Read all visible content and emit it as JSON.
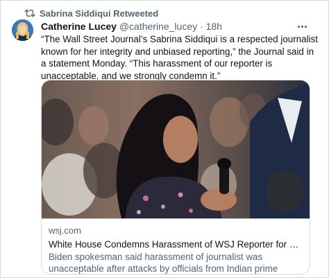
{
  "retweet": {
    "label": "Sabrina Siddiqui Retweeted",
    "icon": "retweet-icon"
  },
  "tweet": {
    "author_name": "Catherine Lucey",
    "author_handle": "@catherine_lucey",
    "separator": "·",
    "time": "18h",
    "text": "“The Wall Street Journal’s Sabrina Siddiqui is a respected journalist known for her integrity and unbiased reporting,” the Journal said in a statement Monday. “This harassment of our reporter is unacceptable, and we strongly condemn it.”"
  },
  "card": {
    "domain": "wsj.com",
    "title": "White House Condemns Harassment of WSJ Reporter for Questionin...",
    "description": "Biden spokesman said harassment of journalist was unacceptable after attacks by officials from Indian prime minister’s party."
  },
  "colors": {
    "text_primary": "#0f1419",
    "text_secondary": "#536471",
    "border": "#cfd9de"
  }
}
